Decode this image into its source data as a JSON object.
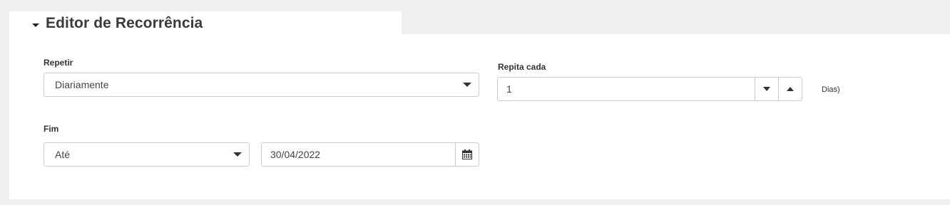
{
  "section": {
    "title": "Editor de Recorrência"
  },
  "repeat": {
    "label": "Repetir",
    "value": "Diariamente"
  },
  "interval": {
    "label": "Repita cada",
    "value": "1",
    "unit": "Dias)"
  },
  "end": {
    "label": "Fim",
    "mode_value": "Até",
    "date_value": "30/04/2022"
  },
  "icons": {
    "section_toggle": "caret-down-icon",
    "select_arrow": "chevron-down-icon",
    "decrement": "caret-down-icon",
    "increment": "caret-up-icon",
    "calendar": "calendar-icon"
  }
}
